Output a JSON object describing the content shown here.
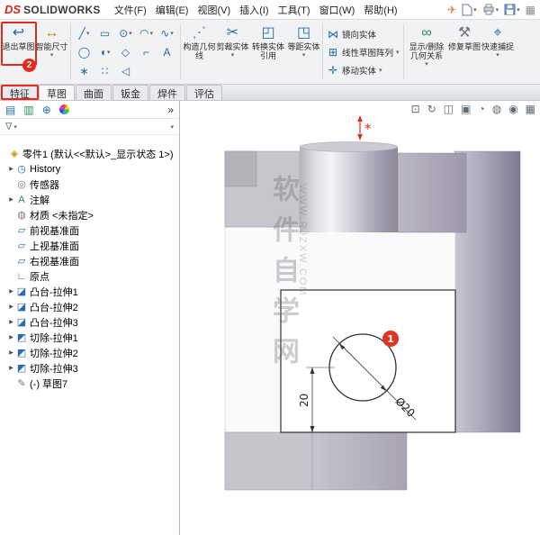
{
  "titlebar": {
    "logo_mark": "DS",
    "logo_text": "SOLIDWORKS",
    "menus": [
      "文件(F)",
      "编辑(E)",
      "视图(V)",
      "插入(I)",
      "工具(T)",
      "窗口(W)",
      "帮助(H)"
    ],
    "launch_glyph": "✈",
    "grid_glyph": "▦",
    "caret": "▾"
  },
  "ribbon": {
    "caret": "▾",
    "exit_sketch": {
      "label": "退出草图",
      "glyph": "↩"
    },
    "smart_dimension": {
      "label": "智能尺寸",
      "glyph": "↔"
    },
    "grid": [
      {
        "glyph": "╱"
      },
      {
        "glyph": "▭"
      },
      {
        "glyph": "⊙"
      },
      {
        "glyph": "◠"
      },
      {
        "glyph": "∿"
      },
      {
        "glyph": "◯"
      },
      {
        "glyph": "◖"
      },
      {
        "glyph": "◇"
      },
      {
        "glyph": "⌐"
      },
      {
        "glyph": "A"
      },
      {
        "glyph": "∗"
      },
      {
        "glyph": "∷"
      },
      {
        "glyph": "◁"
      }
    ],
    "construction": {
      "label": "构造几何线",
      "glyph": "⋰"
    },
    "trim": {
      "label": "剪裁实体",
      "glyph": "✂"
    },
    "convert": {
      "label": "转换实体引用",
      "glyph": "◰"
    },
    "offset": {
      "label": "等距实体",
      "glyph": "◳"
    },
    "mirror": {
      "label": "镜向实体",
      "glyph": "⋈"
    },
    "linear_pattern": {
      "label": "线性草图阵列",
      "glyph": "⊞"
    },
    "move": {
      "label": "移动实体",
      "glyph": "✛"
    },
    "relations": {
      "label": "显示/删除几何关系",
      "glyph": "∞"
    },
    "repair": {
      "label": "修复草图",
      "glyph": "⚒"
    },
    "quick_snaps": {
      "label": "快速捕捉",
      "glyph": "⌖"
    }
  },
  "tabs": {
    "items": [
      "特征",
      "草图",
      "曲面",
      "钣金",
      "焊件",
      "评估"
    ]
  },
  "tree": {
    "panel_icons": [
      {
        "glyph": "▤"
      },
      {
        "glyph": "▥"
      },
      {
        "glyph": "⊕"
      }
    ],
    "chevron": "»",
    "funnel": "∇",
    "arrow": "▶",
    "root": {
      "label": "零件1 (默认<<默认>_显示状态 1>)",
      "glyph": "◈"
    },
    "items": [
      {
        "label": "History",
        "glyph": "◷"
      },
      {
        "label": "传感器",
        "glyph": "◎"
      },
      {
        "label": "注解",
        "glyph": "A"
      },
      {
        "label": "材质 <未指定>",
        "glyph": "◍"
      },
      {
        "label": "前视基准面",
        "glyph": "▱"
      },
      {
        "label": "上视基准面",
        "glyph": "▱"
      },
      {
        "label": "右视基准面",
        "glyph": "▱"
      },
      {
        "label": "原点",
        "glyph": "∟"
      },
      {
        "label": "凸台-拉伸1",
        "glyph": "◪"
      },
      {
        "label": "凸台-拉伸2",
        "glyph": "◪"
      },
      {
        "label": "凸台-拉伸3",
        "glyph": "◪"
      },
      {
        "label": "切除-拉伸1",
        "glyph": "◩"
      },
      {
        "label": "切除-拉伸2",
        "glyph": "◩"
      },
      {
        "label": "切除-拉伸3",
        "glyph": "◩"
      },
      {
        "label": "(-) 草图7",
        "glyph": "✎"
      }
    ]
  },
  "viewport": {
    "headsup": [
      {
        "glyph": "⊡"
      },
      {
        "glyph": "↻"
      },
      {
        "glyph": "◫"
      },
      {
        "glyph": "▣"
      },
      {
        "glyph": "◔"
      },
      {
        "glyph": "◍"
      },
      {
        "glyph": "◉"
      },
      {
        "glyph": "▦"
      }
    ],
    "dim_vertical": "20",
    "dim_diameter": "Ø20",
    "watermark_cn": "软件自学网",
    "watermark_en": "WWW.RJZXW.COM"
  },
  "annotations": {
    "step1": "1",
    "step2": "2"
  }
}
